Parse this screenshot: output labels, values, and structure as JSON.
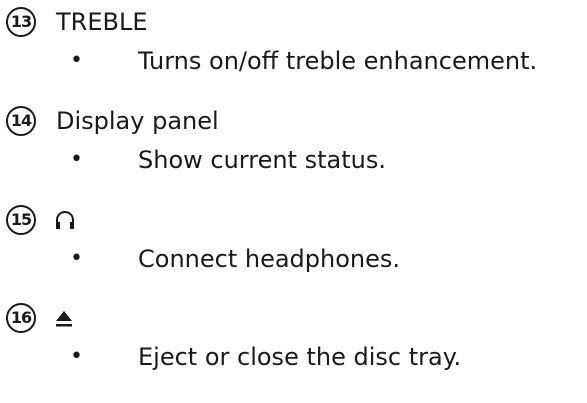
{
  "items": [
    {
      "number": "13",
      "title": "TREBLE",
      "bullet": "•",
      "description": "Turns on/off treble enhancement."
    },
    {
      "number": "14",
      "title": "Display panel",
      "bullet": "•",
      "description": "Show current status."
    },
    {
      "number": "15",
      "icon": "headphones-icon",
      "bullet": "•",
      "description": "Connect headphones."
    },
    {
      "number": "16",
      "icon": "eject-icon",
      "bullet": "•",
      "description": "Eject or close the disc tray."
    }
  ]
}
